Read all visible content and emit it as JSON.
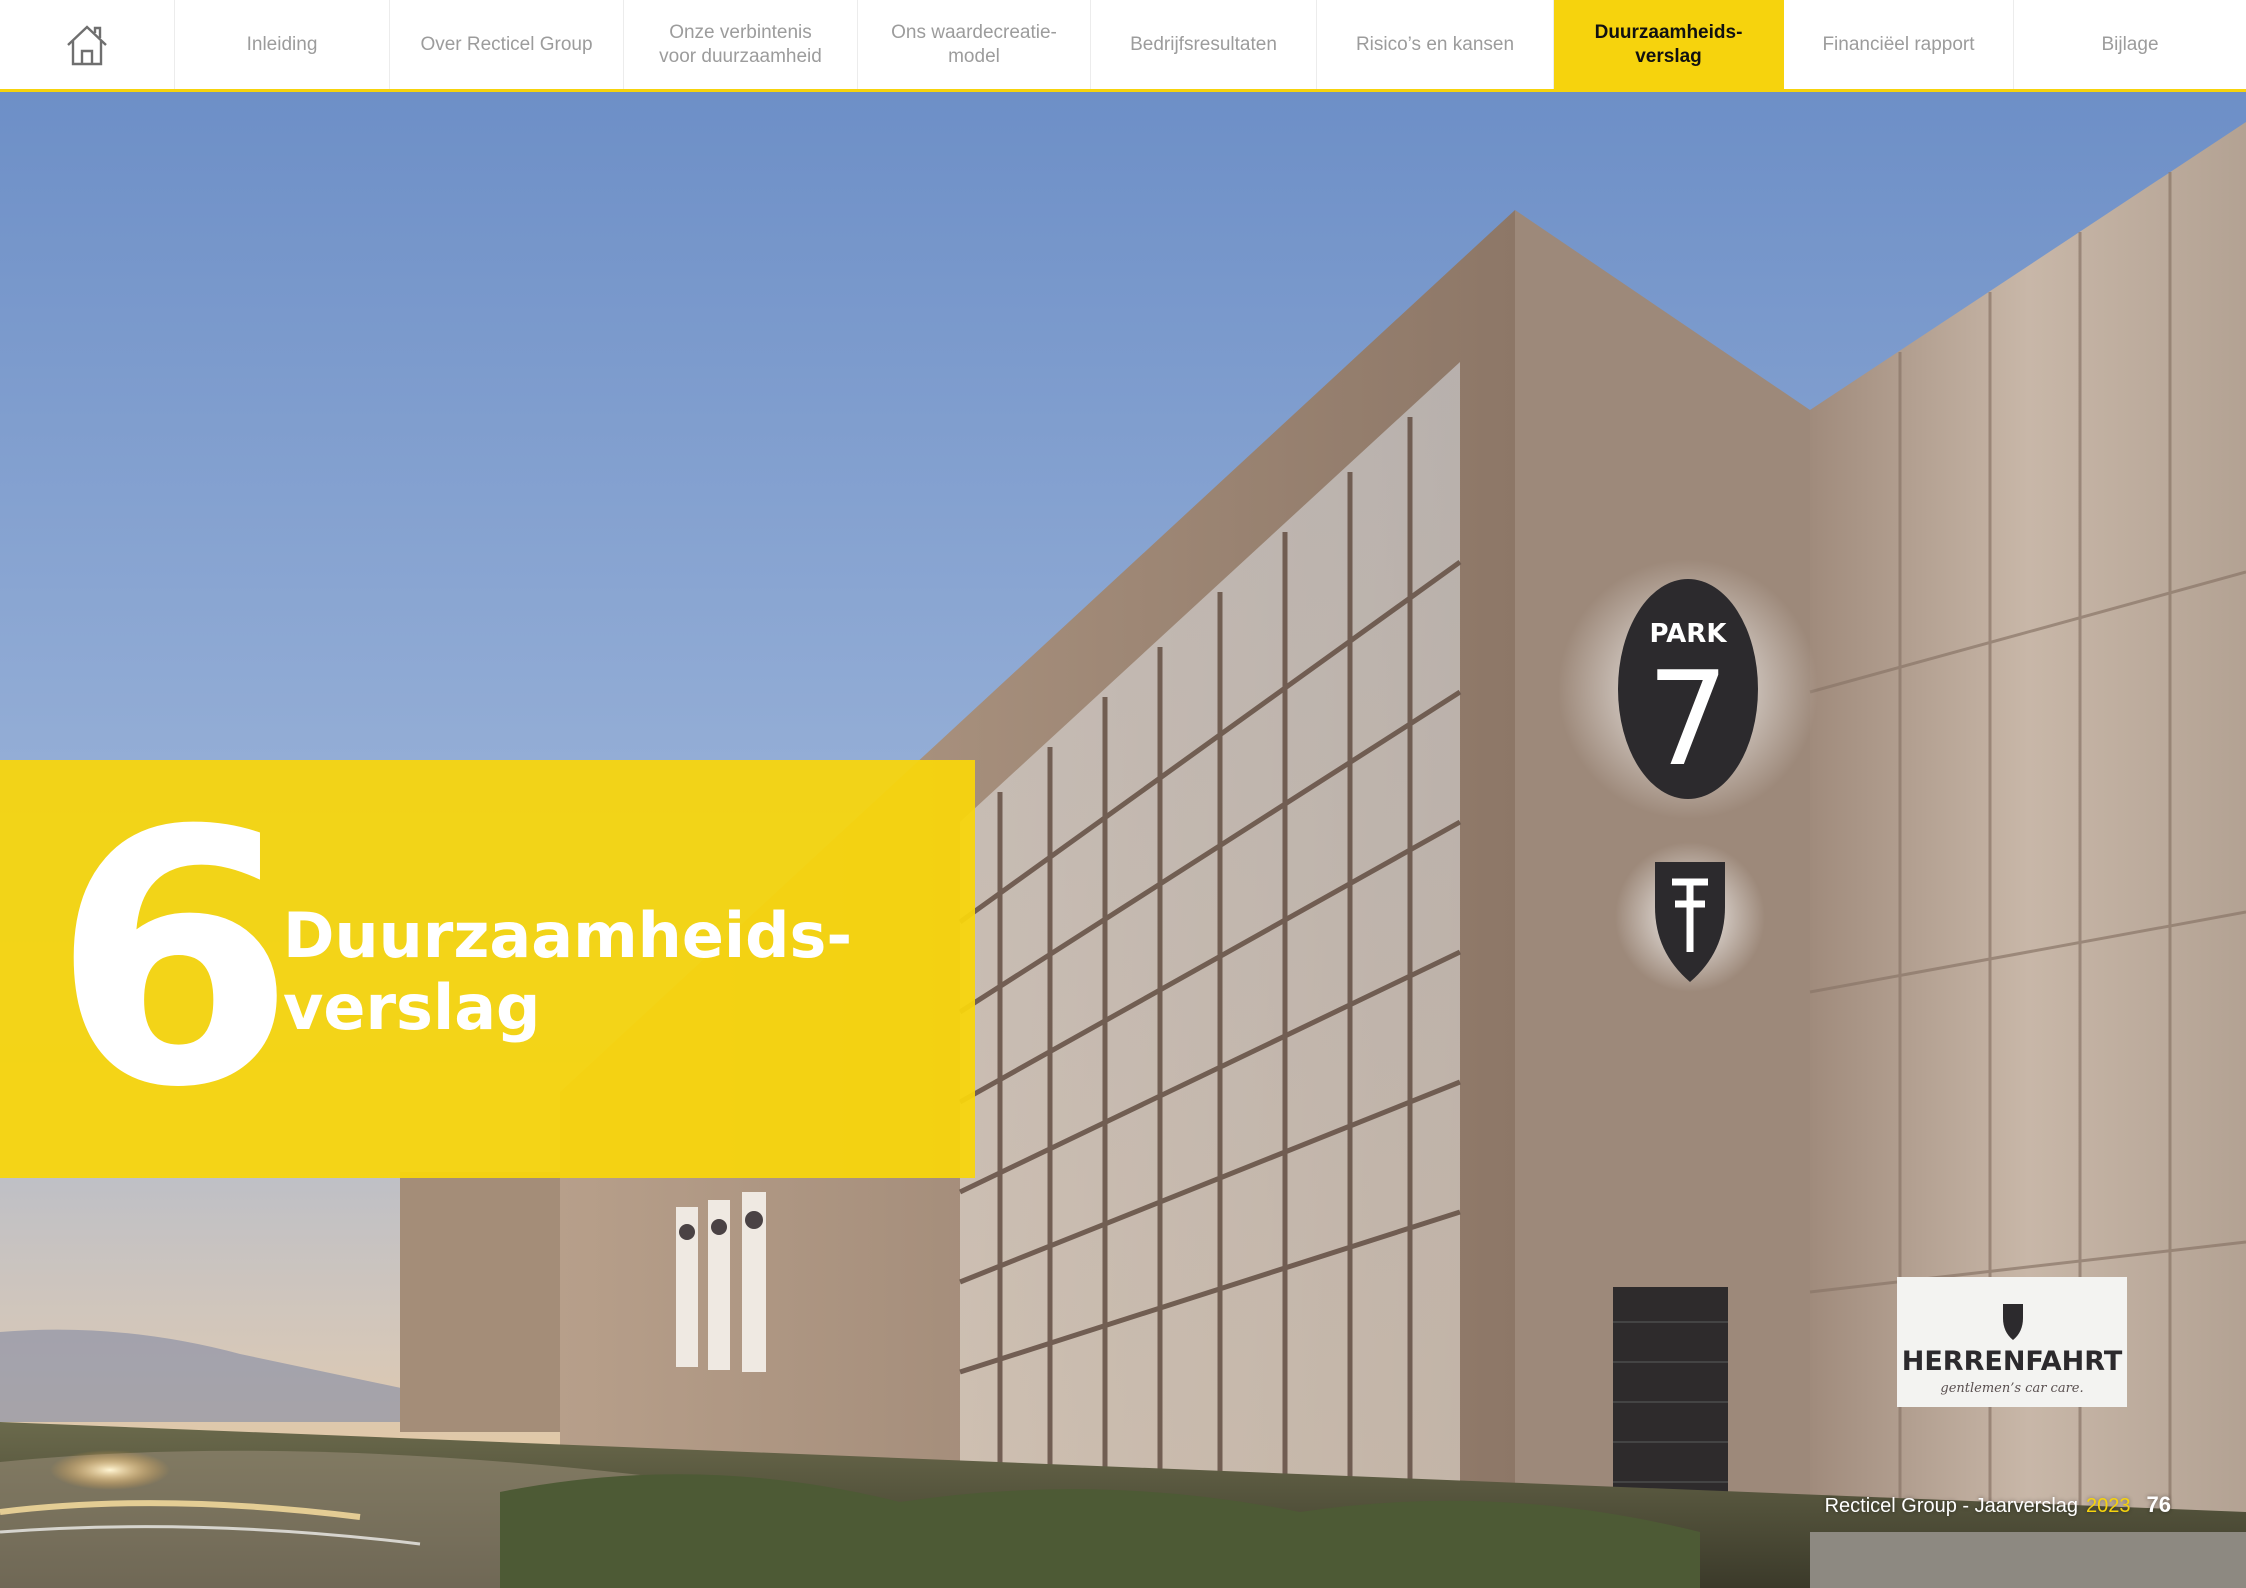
{
  "nav": {
    "home_icon": "home-icon",
    "tabs": [
      {
        "label": "Inleiding",
        "active": false
      },
      {
        "label": "Over Recticel Group",
        "active": false
      },
      {
        "label": "Onze verbintenis\nvoor duurzaamheid",
        "active": false
      },
      {
        "label": "Ons waardecreatie-\nmodel",
        "active": false
      },
      {
        "label": "Bedrijfsresultaten",
        "active": false
      },
      {
        "label": "Risico’s en kansen",
        "active": false
      },
      {
        "label": "Duurzaamheids-\nverslag",
        "active": true
      },
      {
        "label": "Financiëel rapport",
        "active": false
      },
      {
        "label": "Bijlage",
        "active": false
      }
    ],
    "accent_color": "#f6d30d"
  },
  "chapter": {
    "number": "6",
    "title_line1": "Duurzaamheids-",
    "title_line2": "verslag"
  },
  "photo": {
    "sign_top_text": "PARK",
    "sign_number": "7",
    "company_sign_name": "HERRENFAHRT",
    "company_sign_tagline": "gentlemen’s car care."
  },
  "footer": {
    "report": "Recticel Group - Jaarverslag",
    "year": "2023",
    "page": "76"
  }
}
